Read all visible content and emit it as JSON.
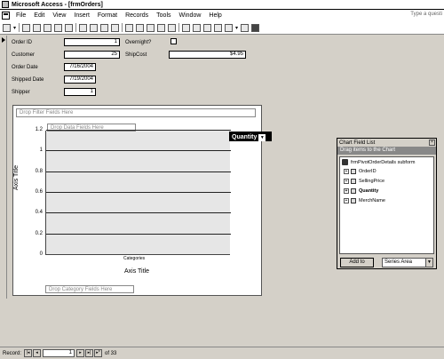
{
  "window": {
    "title": "Microsoft Access - [frmOrders]"
  },
  "menu": {
    "items": [
      "File",
      "Edit",
      "View",
      "Insert",
      "Format",
      "Records",
      "Tools",
      "Window",
      "Help"
    ],
    "help_placeholder": "Type a questi"
  },
  "form": {
    "fields": [
      {
        "label": "Order ID",
        "value": "1"
      },
      {
        "label": "Customer",
        "value": "25"
      },
      {
        "label": "Order Date",
        "value": "7/16/2004"
      },
      {
        "label": "Shipped Date",
        "value": "7/19/2004"
      },
      {
        "label": "Shipper",
        "value": "1"
      }
    ],
    "overnight_label": "Overnight?",
    "overnight_checked": false,
    "shipcost_label": "ShipCost",
    "shipcost_value": "$4.95"
  },
  "pivot": {
    "drop_filter": "Drop Filter Fields Here",
    "drop_data": "Drop Data Fields Here",
    "drop_category": "Drop Category Fields Here",
    "series_button": "Quantity",
    "chart_data": {
      "type": "bar",
      "categories": [
        "Categories"
      ],
      "series": [],
      "xlabel": "Axis Title",
      "ylabel": "Axis Title",
      "ylim": [
        0,
        1.2
      ],
      "yticks": [
        "0",
        "0.2",
        "0.4",
        "0.6",
        "0.8",
        "1",
        "1.2"
      ],
      "grid": true
    }
  },
  "field_list": {
    "title": "Chart Field List",
    "header": "Drag items to the Chart",
    "root": "frmPivotOrderDetails subform",
    "fields": [
      "OrderID",
      "SellingPrice",
      "Quantity",
      "MerchName"
    ],
    "add_button": "Add to",
    "area_value": "Series Area"
  },
  "status": {
    "record_label": "Record:",
    "record_value": "1",
    "of_text": "of  33"
  }
}
